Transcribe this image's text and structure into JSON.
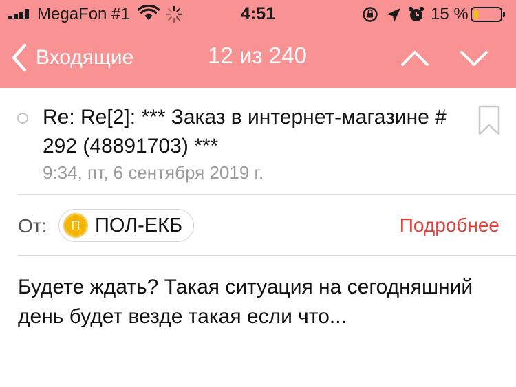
{
  "status_bar": {
    "carrier": "MegaFon #1",
    "time": "4:51",
    "battery_percent": "15 %",
    "battery_level": 0.15,
    "battery_color": "#f4c300",
    "icons": [
      "signal-icon",
      "wifi-icon",
      "activity-spinner-icon",
      "rotation-lock-icon",
      "location-icon",
      "alarm-icon",
      "battery-icon"
    ]
  },
  "nav": {
    "back_label": "Входящие",
    "counter": "12 из 240",
    "bar_color": "#f99292"
  },
  "message": {
    "subject": "Re: Re[2]: *** Заказ в интернет-магазине # 292 (48891703) ***",
    "date": "9:34, пт, 6 сентября 2019 г.",
    "from_label": "От:",
    "sender_initial": "П",
    "sender_name": "ПОЛ-ЕКБ",
    "details_link": "Подробнее",
    "body": "Будете ждать? Такая ситуация на сегодняшний день будет везде такая если что..."
  }
}
